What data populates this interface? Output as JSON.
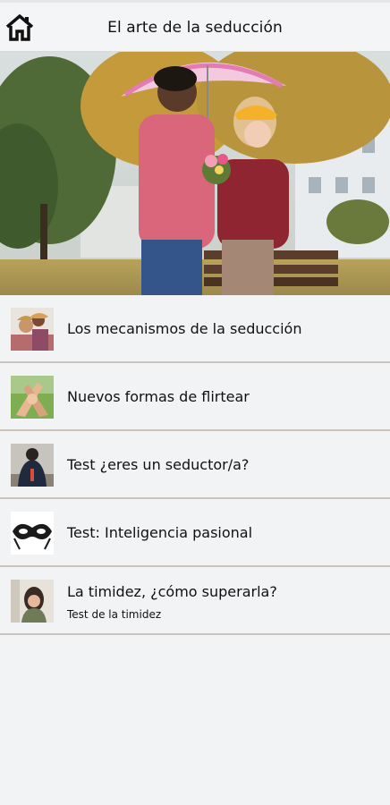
{
  "header": {
    "title": "El arte de la seducción",
    "home_icon": "home-icon"
  },
  "hero": {
    "image": "couple-umbrella-park-photo"
  },
  "menu": {
    "items": [
      {
        "label": "Los mecanismos de la seducción",
        "subtitle": "",
        "icon": "couple-photo-thumb"
      },
      {
        "label": "Nuevos formas de flirtear",
        "subtitle": "",
        "icon": "holding-hands-photo-thumb"
      },
      {
        "label": "Test ¿eres un seductor/a?",
        "subtitle": "",
        "icon": "hug-photo-thumb"
      },
      {
        "label": "Test: Inteligencia pasional",
        "subtitle": "",
        "icon": "lace-mask-thumb"
      },
      {
        "label": "La timidez, ¿cómo superarla?",
        "subtitle": "Test de la timidez",
        "icon": "shy-woman-photo-thumb"
      }
    ]
  },
  "colors": {
    "background": "#f2f3f5",
    "divider": "#c9c2bd"
  }
}
